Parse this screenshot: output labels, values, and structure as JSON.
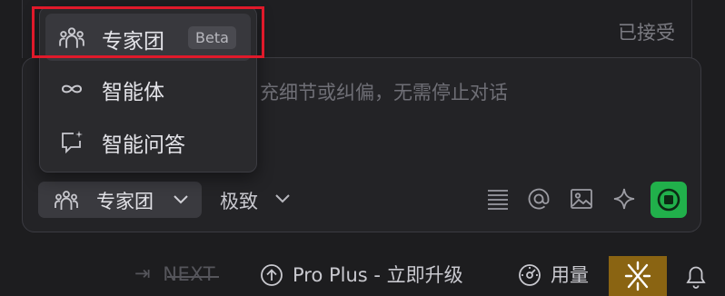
{
  "status": {
    "accepted_label": "已接受"
  },
  "input": {
    "placeholder": "充细节或纠偏，无需停止对话"
  },
  "dropdown": {
    "items": [
      {
        "label": "专家团",
        "badge": "Beta",
        "icon": "team-icon",
        "selected": true
      },
      {
        "label": "智能体",
        "icon": "infinity-icon"
      },
      {
        "label": "智能问答",
        "icon": "chat-spark-icon"
      }
    ]
  },
  "toolbar": {
    "mode_label": "专家团",
    "mode_icon": "team-icon",
    "quality_label": "极致",
    "tools": [
      "list-icon",
      "at-icon",
      "image-icon",
      "sparkle-icon",
      "send-stop-icon"
    ],
    "send_color": "#21b04b"
  },
  "footer": {
    "next_label": "NEXT",
    "upgrade_label": "Pro Plus - 立即升级",
    "usage_label": "用量",
    "logo_color": "#8a6412"
  },
  "colors": {
    "highlight": "#e0192a"
  }
}
